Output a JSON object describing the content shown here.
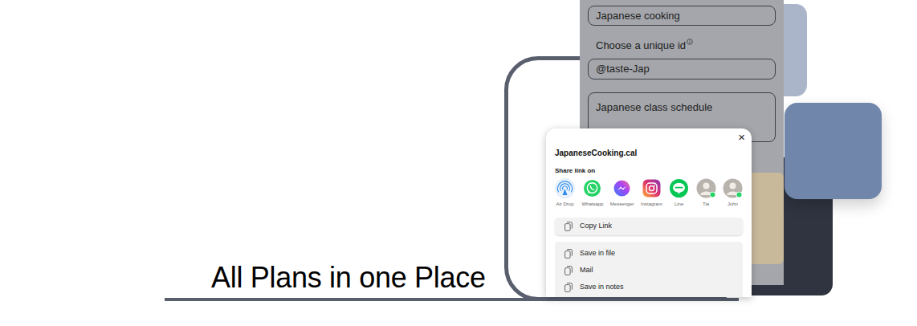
{
  "headline": "All Plans in one Place",
  "form": {
    "name_value": "Japanese cooking",
    "id_label": "Choose a unique id",
    "id_value": "@taste-Jap",
    "description_value": "Japanese class schedule"
  },
  "share_sheet": {
    "title": "JapaneseCooking.cal",
    "close": "×",
    "share_label": "Share link on",
    "targets": [
      {
        "label": "Air Drop",
        "kind": "airdrop"
      },
      {
        "label": "Whatsapp",
        "kind": "whatsapp"
      },
      {
        "label": "Messenger",
        "kind": "messenger"
      },
      {
        "label": "Instagram",
        "kind": "instagram"
      },
      {
        "label": "Line",
        "kind": "line"
      },
      {
        "label": "Tia",
        "kind": "contact"
      },
      {
        "label": "John",
        "kind": "contact"
      }
    ],
    "copy_action": "Copy Link",
    "actions": [
      "Save in file",
      "Mail",
      "Save in notes"
    ]
  }
}
